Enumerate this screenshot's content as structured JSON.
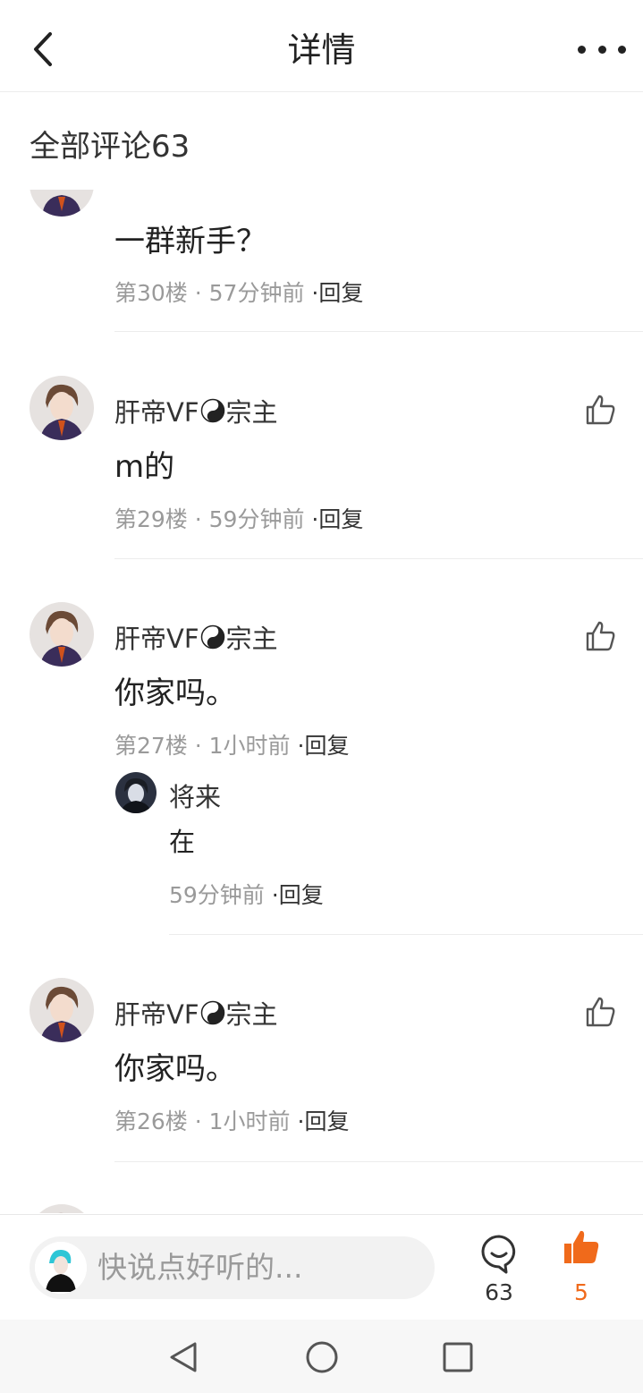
{
  "header": {
    "title": "详情",
    "back_icon": "chevron-left-icon",
    "more_icon": "more-dots-icon"
  },
  "section": {
    "title": "全部评论63"
  },
  "comments": [
    {
      "text": "一群新手？",
      "floor": "第30楼",
      "time": "57分钟前",
      "reply_label": "·回复"
    },
    {
      "name_prefix": "肝帝VF",
      "name_suffix": "宗主",
      "text": "m的",
      "floor": "第29楼",
      "time": "59分钟前",
      "reply_label": "·回复"
    },
    {
      "name_prefix": "肝帝VF",
      "name_suffix": "宗主",
      "text": "你家吗。",
      "floor": "第27楼",
      "time": "1小时前",
      "reply_label": "·回复",
      "sub_reply": {
        "name": "将来",
        "text": "在",
        "time": "59分钟前",
        "reply_label": "·回复"
      }
    },
    {
      "name_prefix": "肝帝VF",
      "name_suffix": "宗主",
      "text": "你家吗。",
      "floor": "第26楼",
      "time": "1小时前",
      "reply_label": "·回复"
    }
  ],
  "meta_separator": " · ",
  "bottom_bar": {
    "placeholder": "快说点好听的...",
    "comment_count": "63",
    "like_count": "5",
    "accent_color": "#f06a1b"
  },
  "nav": {
    "back_icon": "triangle-back-icon",
    "home_icon": "circle-home-icon",
    "recents_icon": "square-recents-icon"
  }
}
